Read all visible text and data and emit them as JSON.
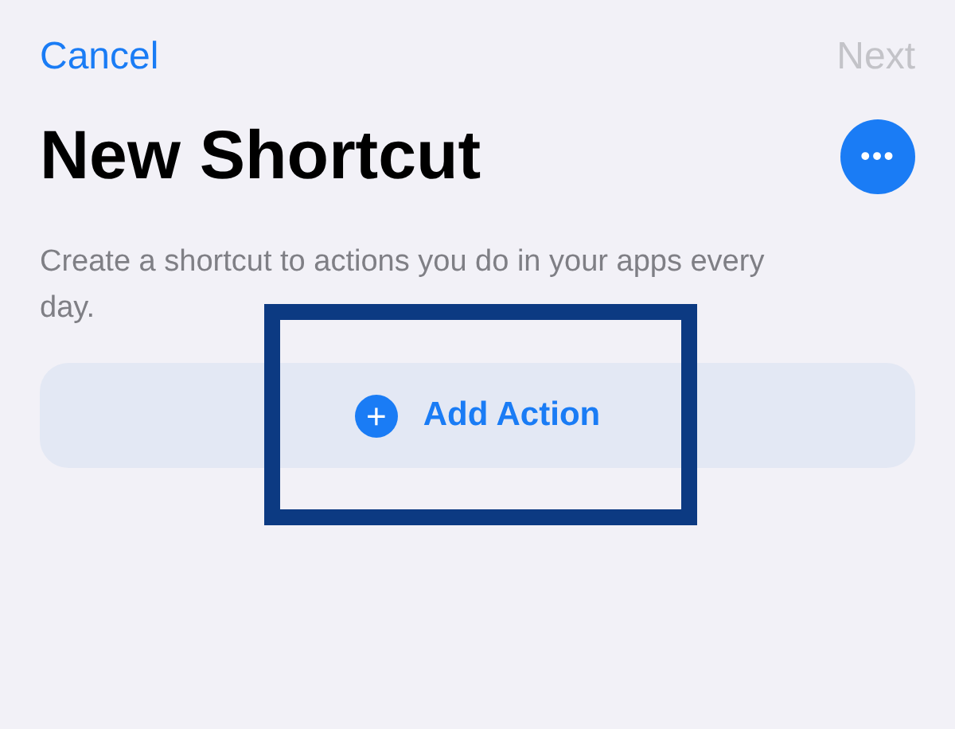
{
  "nav": {
    "cancel": "Cancel",
    "next": {
      "label": "Next",
      "disabled": true
    }
  },
  "title": "New Shortcut",
  "more_button": {
    "label": "•••"
  },
  "description": "Create a shortcut to actions you do in your apps every day.",
  "add_action": {
    "icon": "+",
    "label": "Add Action",
    "highlighted": true
  }
}
